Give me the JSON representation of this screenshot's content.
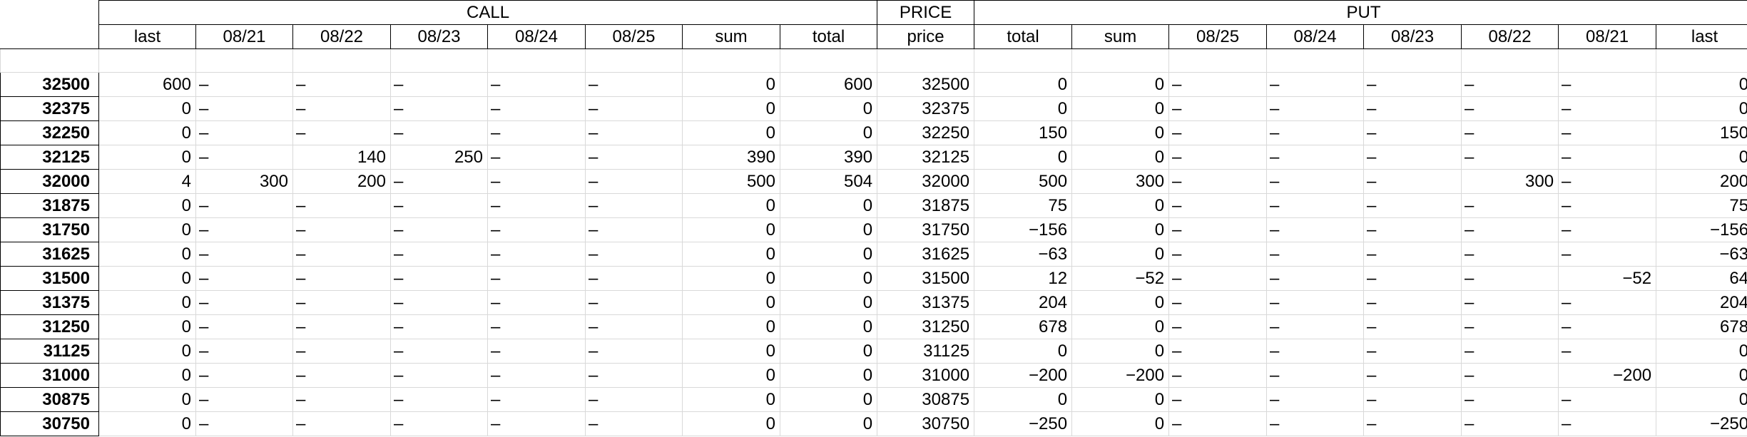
{
  "groups": {
    "call": "CALL",
    "price": "PRICE",
    "put": "PUT"
  },
  "columns": [
    "last",
    "08/21",
    "08/22",
    "08/23",
    "08/24",
    "08/25",
    "sum",
    "total",
    "price",
    "total",
    "sum",
    "08/25",
    "08/24",
    "08/23",
    "08/22",
    "08/21",
    "last"
  ],
  "rows": [
    {
      "strike": "32500",
      "cells": [
        "600",
        "–",
        "–",
        "–",
        "–",
        "–",
        "0",
        "600",
        "32500",
        "0",
        "0",
        "–",
        "–",
        "–",
        "–",
        "–",
        "0"
      ]
    },
    {
      "strike": "32375",
      "cells": [
        "0",
        "–",
        "–",
        "–",
        "–",
        "–",
        "0",
        "0",
        "32375",
        "0",
        "0",
        "–",
        "–",
        "–",
        "–",
        "–",
        "0"
      ]
    },
    {
      "strike": "32250",
      "cells": [
        "0",
        "–",
        "–",
        "–",
        "–",
        "–",
        "0",
        "0",
        "32250",
        "150",
        "0",
        "–",
        "–",
        "–",
        "–",
        "–",
        "150"
      ]
    },
    {
      "strike": "32125",
      "cells": [
        "0",
        "–",
        "140",
        "250",
        "–",
        "–",
        "390",
        "390",
        "32125",
        "0",
        "0",
        "–",
        "–",
        "–",
        "–",
        "–",
        "0"
      ]
    },
    {
      "strike": "32000",
      "cells": [
        "4",
        "300",
        "200",
        "–",
        "–",
        "–",
        "500",
        "504",
        "32000",
        "500",
        "300",
        "–",
        "–",
        "–",
        "300",
        "–",
        "200"
      ]
    },
    {
      "strike": "31875",
      "cells": [
        "0",
        "–",
        "–",
        "–",
        "–",
        "–",
        "0",
        "0",
        "31875",
        "75",
        "0",
        "–",
        "–",
        "–",
        "–",
        "–",
        "75"
      ]
    },
    {
      "strike": "31750",
      "cells": [
        "0",
        "–",
        "–",
        "–",
        "–",
        "–",
        "0",
        "0",
        "31750",
        "−156",
        "0",
        "–",
        "–",
        "–",
        "–",
        "–",
        "−156"
      ]
    },
    {
      "strike": "31625",
      "cells": [
        "0",
        "–",
        "–",
        "–",
        "–",
        "–",
        "0",
        "0",
        "31625",
        "−63",
        "0",
        "–",
        "–",
        "–",
        "–",
        "–",
        "−63"
      ]
    },
    {
      "strike": "31500",
      "cells": [
        "0",
        "–",
        "–",
        "–",
        "–",
        "–",
        "0",
        "0",
        "31500",
        "12",
        "−52",
        "–",
        "–",
        "–",
        "–",
        "−52",
        "64"
      ]
    },
    {
      "strike": "31375",
      "cells": [
        "0",
        "–",
        "–",
        "–",
        "–",
        "–",
        "0",
        "0",
        "31375",
        "204",
        "0",
        "–",
        "–",
        "–",
        "–",
        "–",
        "204"
      ]
    },
    {
      "strike": "31250",
      "cells": [
        "0",
        "–",
        "–",
        "–",
        "–",
        "–",
        "0",
        "0",
        "31250",
        "678",
        "0",
        "–",
        "–",
        "–",
        "–",
        "–",
        "678"
      ]
    },
    {
      "strike": "31125",
      "cells": [
        "0",
        "–",
        "–",
        "–",
        "–",
        "–",
        "0",
        "0",
        "31125",
        "0",
        "0",
        "–",
        "–",
        "–",
        "–",
        "–",
        "0"
      ]
    },
    {
      "strike": "31000",
      "cells": [
        "0",
        "–",
        "–",
        "–",
        "–",
        "–",
        "0",
        "0",
        "31000",
        "−200",
        "−200",
        "–",
        "–",
        "–",
        "–",
        "−200",
        "0"
      ]
    },
    {
      "strike": "30875",
      "cells": [
        "0",
        "–",
        "–",
        "–",
        "–",
        "–",
        "0",
        "0",
        "30875",
        "0",
        "0",
        "–",
        "–",
        "–",
        "–",
        "–",
        "0"
      ]
    },
    {
      "strike": "30750",
      "cells": [
        "0",
        "–",
        "–",
        "–",
        "–",
        "–",
        "0",
        "0",
        "30750",
        "−250",
        "0",
        "–",
        "–",
        "–",
        "–",
        "–",
        "−250"
      ]
    }
  ]
}
